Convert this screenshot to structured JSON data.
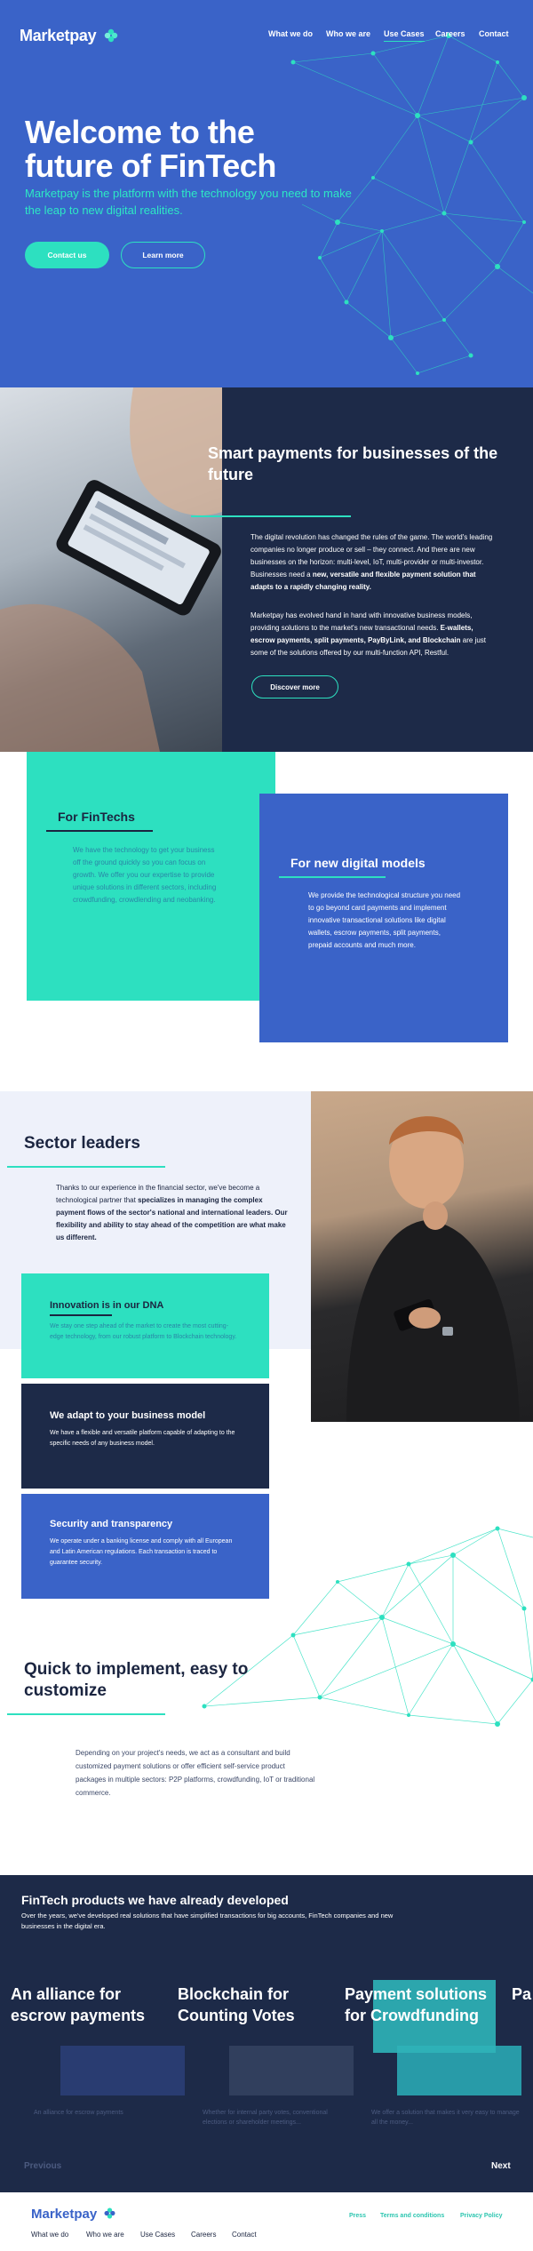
{
  "brand": {
    "name": "Marketpay",
    "accent": "#2de0c0",
    "blue": "#3a63c8",
    "navy": "#1d2a48"
  },
  "nav": [
    {
      "label": "What we do"
    },
    {
      "label": "Who we are"
    },
    {
      "label": "Use Cases"
    },
    {
      "label": "Careers"
    },
    {
      "label": "Contact"
    }
  ],
  "hero": {
    "title": "Welcome to the future of FinTech",
    "subtitle": "Marketpay is the platform with the technology you need to make the leap to new digital realities.",
    "contact_label": "Contact us",
    "learn_label": "Learn more"
  },
  "smart": {
    "title": "Smart payments for businesses of the future",
    "p1_a": "The digital revolution has changed the rules of the game. The world's leading companies no longer produce or sell – they connect. And there are new businesses on the horizon: multi-level, IoT, multi-provider or multi-investor. Businesses need a ",
    "p1_b": "new, versatile and flexible payment solution that adapts to a rapidly changing reality.",
    "p2_a": "Marketpay has evolved hand in hand with innovative business models, providing solutions to the market's new transactional needs. ",
    "p2_b": "E-wallets, escrow payments, split payments, PayByLink, and Blockchain",
    "p2_c": " are just some of the solutions offered by our multi-function API, Restful.",
    "discover_label": "Discover more"
  },
  "cards": {
    "fintech_title": "For FinTechs",
    "fintech_text": "We have the technology to get your business off the ground quickly so you can focus on growth. We offer you our expertise to provide unique solutions in different sectors, including crowdfunding, crowdlending and neobanking.",
    "digital_title": "For new digital models",
    "digital_text": "We provide the technological structure you need to go beyond card payments and implement innovative transactional solutions like digital wallets, escrow payments, split payments, prepaid accounts and much more."
  },
  "sector": {
    "title": "Sector leaders",
    "text_a": "Thanks to our experience in the financial sector, we've become a technological partner that ",
    "text_b": "specializes in managing the complex payment flows of the sector's national and international leaders. Our flexibility and ability to stay ahead of the competition are what make us different.",
    "features": [
      {
        "title": "Innovation is in our DNA",
        "text": "We stay one step ahead of the market to create the most cutting-edge technology, from our robust platform to Blockchain technology."
      },
      {
        "title": "We adapt to your business model",
        "text": "We have a flexible and versatile platform capable of adapting to the specific needs of any business model."
      },
      {
        "title": "Security and transparency",
        "text": "We operate under a banking license and comply with all European and Latin American regulations. Each transaction is traced to guarantee security."
      }
    ]
  },
  "quick": {
    "title": "Quick to implement, easy to customize",
    "text": "Depending on your project's needs, we act as a consultant and build customized payment solutions or offer efficient self-service product packages in multiple sectors: P2P platforms, crowdfunding, IoT or traditional commerce."
  },
  "products": {
    "title": "FinTech products we have already developed",
    "subtitle": "Over the years, we've developed real solutions that have simplified transactions for big accounts, FinTech companies and new businesses in the digital era.",
    "slides": [
      {
        "title": "An alliance for escrow payments",
        "text": "An alliance for escrow payments"
      },
      {
        "title": "Blockchain for Counting Votes",
        "text": "Whether for internal party votes, conventional elections or shareholder meetings..."
      },
      {
        "title": "Payment solutions for Crowdfunding",
        "text": "We offer a solution that makes it very easy to manage all the money..."
      },
      {
        "title": "Pa"
      }
    ],
    "prev_label": "Previous",
    "next_label": "Next"
  },
  "footer": {
    "logo": "Marketpay",
    "links": [
      "What we do",
      "Who we are",
      "Use Cases",
      "Careers",
      "Contact"
    ],
    "legal": [
      "Press",
      "Terms and conditions",
      "Privacy Policy"
    ]
  }
}
